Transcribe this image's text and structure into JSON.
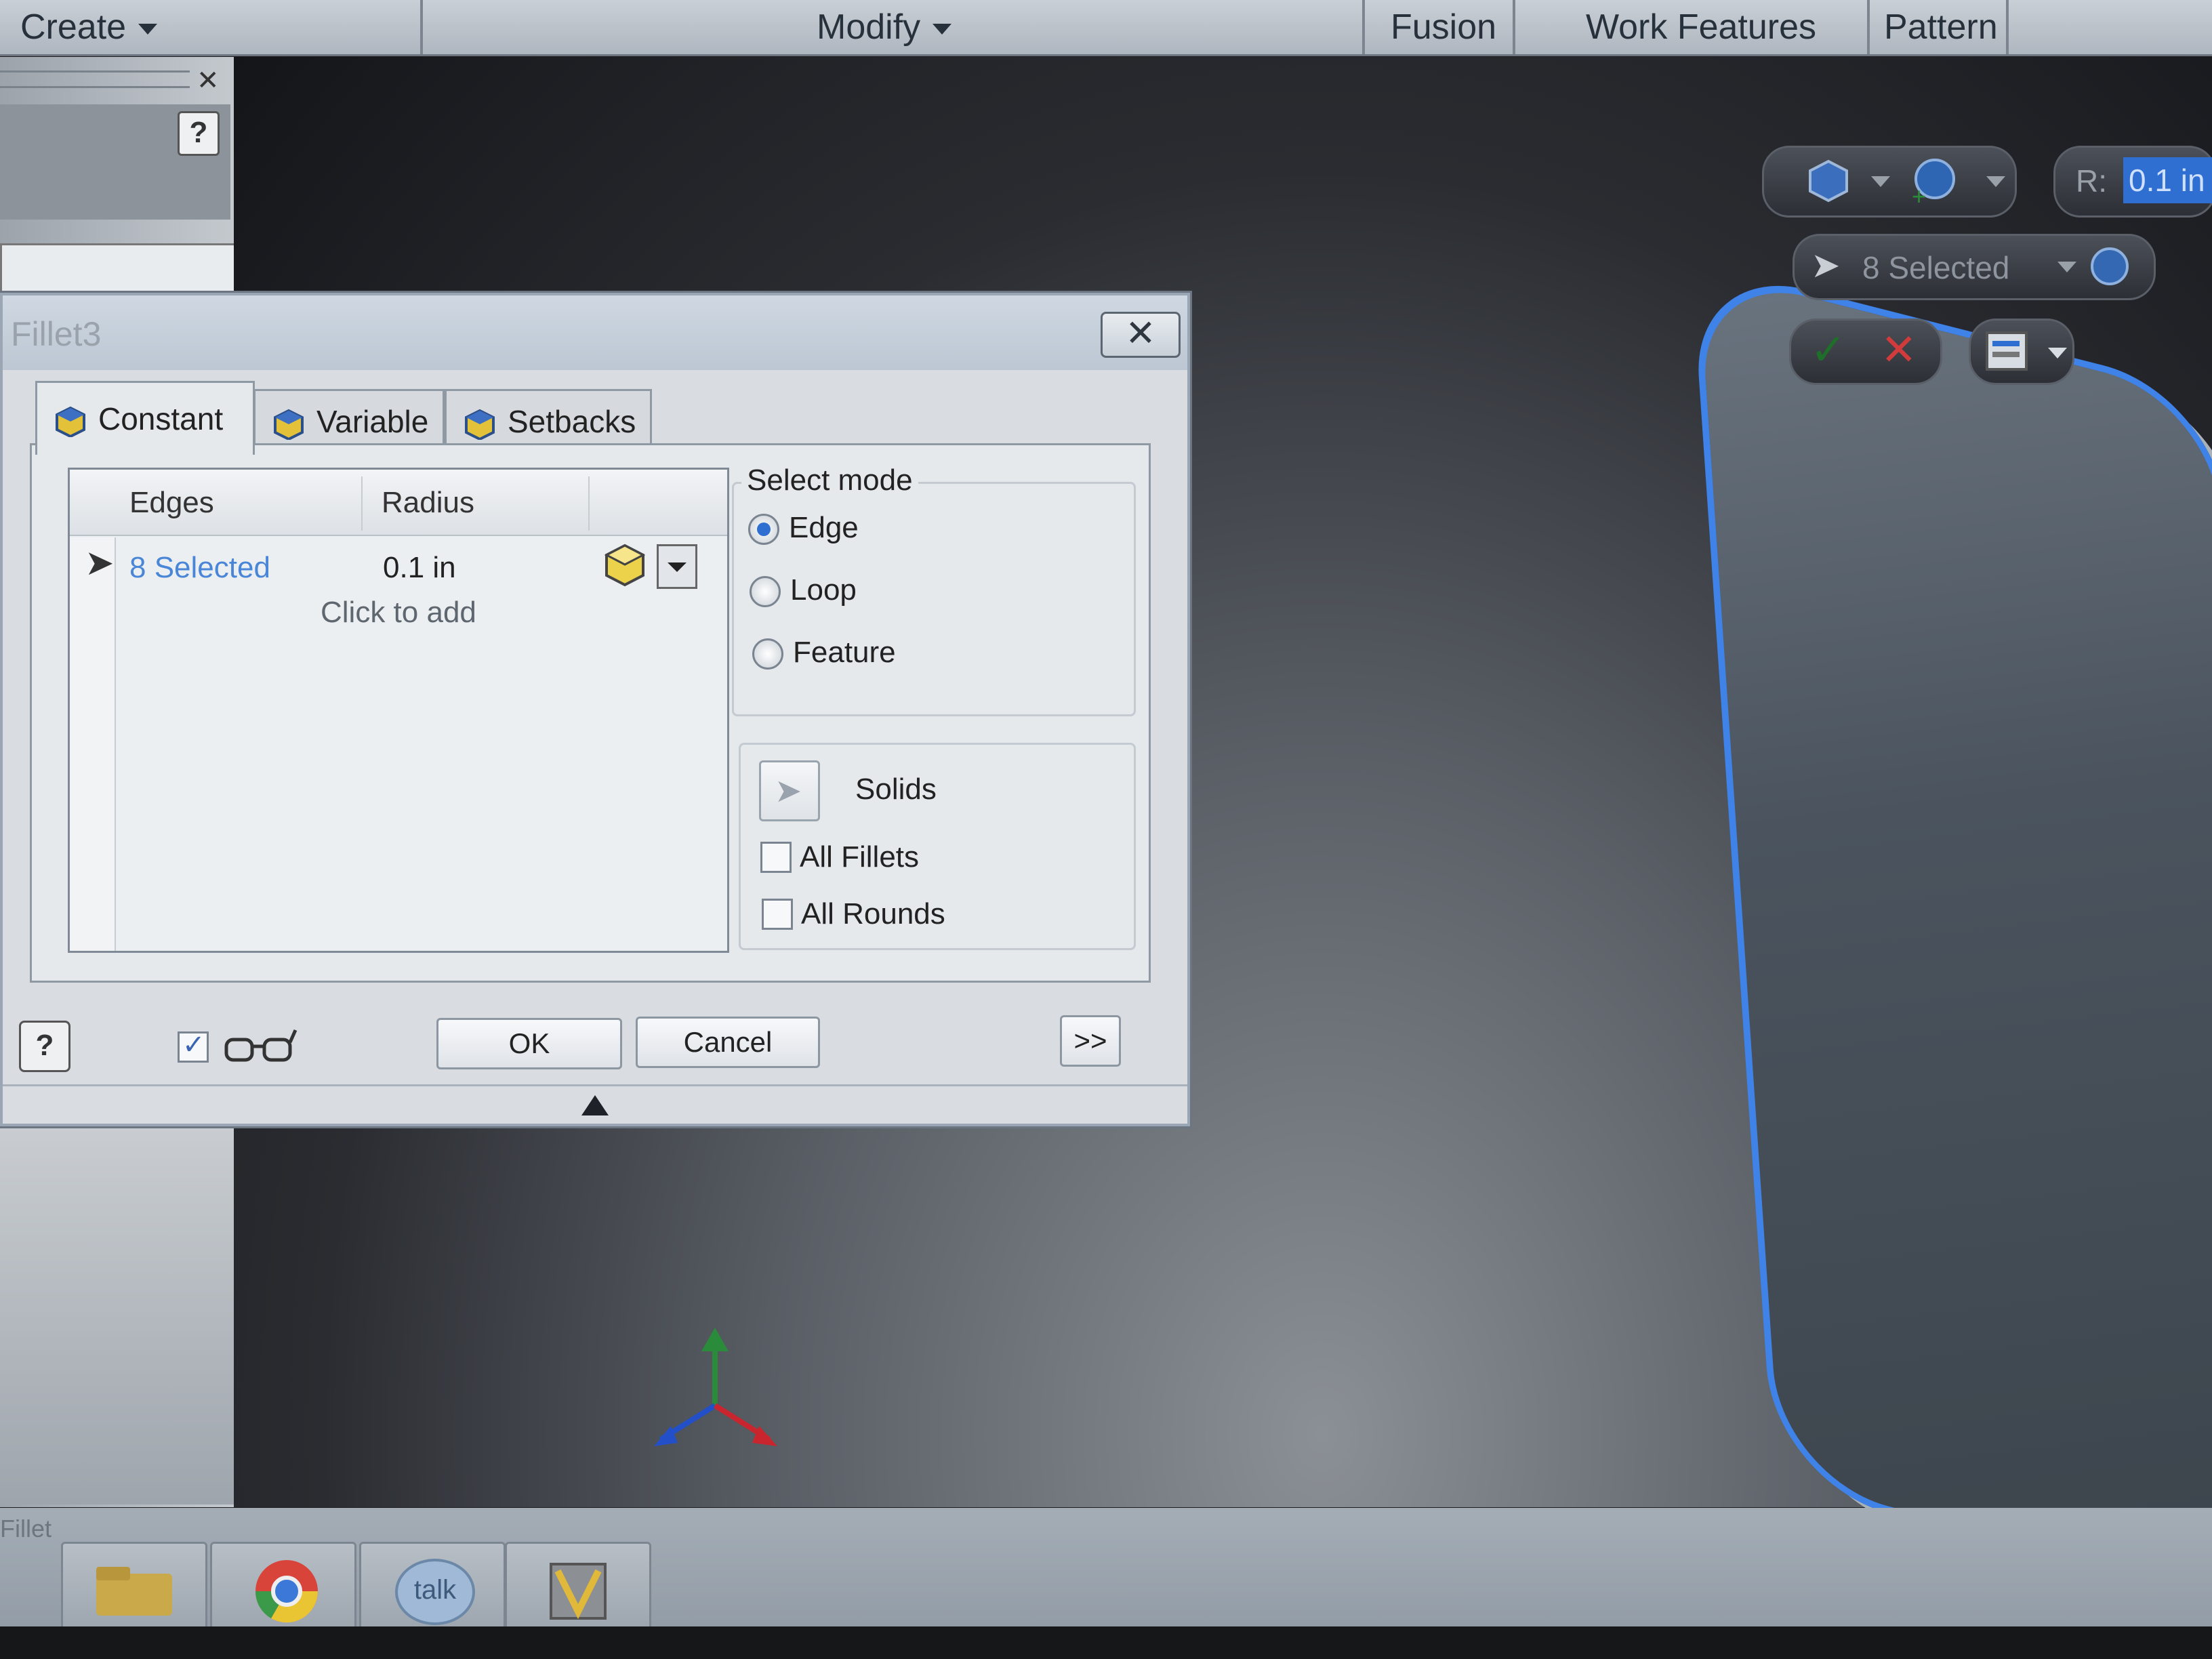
{
  "ribbon": {
    "create": "Create",
    "modify": "Modify",
    "fusion": "Fusion",
    "work_features": "Work Features",
    "pattern": "Pattern"
  },
  "mini_toolbar": {
    "radius_prefix": "R:",
    "radius_value": "0.1 in",
    "selected": "8 Selected"
  },
  "dialog": {
    "title": "Fillet3",
    "tabs": [
      {
        "label": "Constant",
        "active": true
      },
      {
        "label": "Variable",
        "active": false
      },
      {
        "label": "Setbacks",
        "active": false
      }
    ],
    "table": {
      "headers": [
        "Edges",
        "Radius"
      ],
      "rows": [
        {
          "edges": "8 Selected",
          "radius": "0.1 in"
        }
      ],
      "add_prompt": "Click to add"
    },
    "select_mode": {
      "title": "Select mode",
      "options": [
        "Edge",
        "Loop",
        "Feature"
      ],
      "selected": "Edge"
    },
    "solids_label": "Solids",
    "checks": [
      {
        "label": "All Fillets",
        "checked": false
      },
      {
        "label": "All Rounds",
        "checked": false
      }
    ],
    "preview_checked": true,
    "ok": "OK",
    "cancel": "Cancel",
    "more": ">>"
  },
  "taskbar": {
    "status": "Fillet",
    "talk": "talk"
  },
  "colors": {
    "accent_blue": "#3f82e8",
    "link_blue": "#4a86d8",
    "cancel_red": "#d13b3b",
    "ok_green": "#1f6e2a"
  }
}
